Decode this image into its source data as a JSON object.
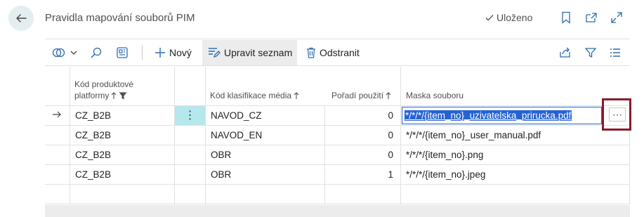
{
  "header": {
    "title": "Pravidla mapování souborů PIM",
    "status": "Uloženo"
  },
  "toolbar": {
    "new_label": "Nový",
    "edit_list_label": "Upravit seznam",
    "delete_label": "Odstranit"
  },
  "columns": {
    "platform_line1": "Kód produktové",
    "platform_line2": "platformy",
    "media": "Kód klasifikace média",
    "order": "Pořadí použití",
    "mask": "Maska souboru"
  },
  "rows": [
    {
      "platform": "CZ_B2B",
      "media": "NAVOD_CZ",
      "order": "0",
      "mask": "*/*/*/{item_no}_uzivatelska_prirucka.pdf"
    },
    {
      "platform": "CZ_B2B",
      "media": "NAVOD_EN",
      "order": "0",
      "mask": "*/*/*/{item_no}_user_manual.pdf"
    },
    {
      "platform": "CZ_B2B",
      "media": "OBR",
      "order": "0",
      "mask": "*/*/*/{item_no}.png"
    },
    {
      "platform": "CZ_B2B",
      "media": "OBR",
      "order": "1",
      "mask": "*/*/*/{item_no}.jpeg"
    }
  ],
  "icons": {
    "back": "arrow-left-icon",
    "saved": "checkmark-icon",
    "bookmark": "bookmark-icon",
    "open_new": "open-in-new-window-icon",
    "expand": "expand-icon",
    "flow": "flow-icon",
    "search": "search-icon",
    "layout": "layout-icon",
    "share": "share-icon",
    "filter": "filter-icon",
    "list": "list-view-icon"
  },
  "colors": {
    "accent": "#2563d4",
    "highlight_border": "#8b1a2b",
    "selected_actions": "#b5e8ec"
  }
}
